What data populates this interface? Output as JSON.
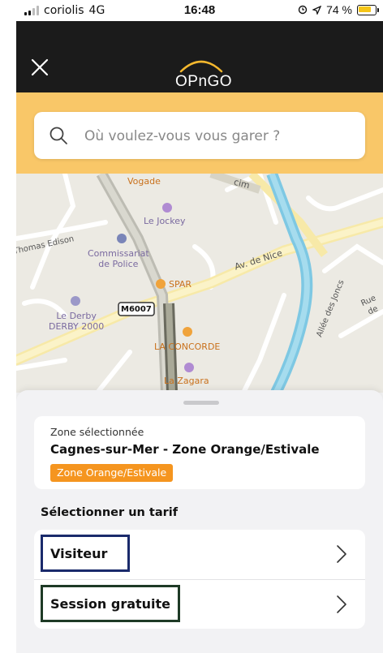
{
  "status_bar": {
    "carrier": "coriolis",
    "network": "4G",
    "time": "16:48",
    "battery": "74 %"
  },
  "header": {
    "logo_text": "OPnGO",
    "close_icon": "close-icon"
  },
  "search": {
    "placeholder": "Où voulez-vous vous garer ?",
    "icon": "search-icon"
  },
  "map": {
    "labels": {
      "vogade": "Vogade",
      "le_jockey": "Le Jockey",
      "thomas_edison": "Thomas Edison",
      "commissariat": "Commissariat",
      "de_police": "de Police",
      "av_de_nice": "Av. de Nice",
      "spar": "SPAR",
      "m6007": "M6007",
      "le_derby": "Le Derby",
      "derby_2000": "DERBY 2000",
      "la_concorde": "LA CONCORDE",
      "la_zagara": "La Zagara",
      "allee_des_joncs": "Allée des Joncs",
      "rue_de": "Rue de",
      "cim": "cim"
    }
  },
  "zone": {
    "caption": "Zone sélectionnée",
    "name": "Cagnes-sur-Mer - Zone Orange/Estivale",
    "badge": "Zone Orange/Estivale",
    "badge_color": "#f5951f"
  },
  "tarif": {
    "title": "Sélectionner un tarif",
    "items": [
      {
        "label": "Visiteur"
      },
      {
        "label": "Session gratuite"
      }
    ]
  },
  "colors": {
    "header": "#1b1b1b",
    "search_band": "#f9c768",
    "highlight_visitor": "#1a2a6b",
    "highlight_session": "#1e3a26"
  }
}
